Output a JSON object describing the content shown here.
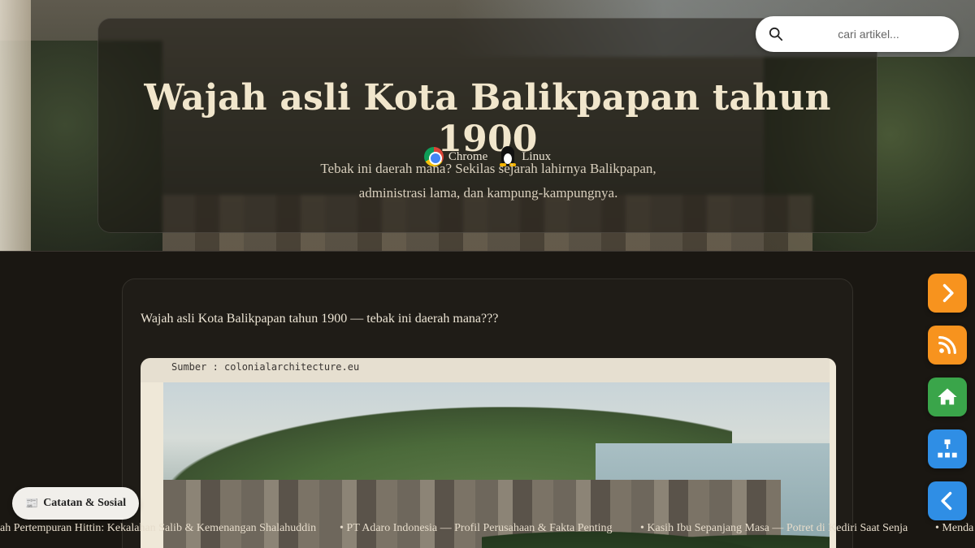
{
  "hero": {
    "title": "Wajah asli Kota Balikpapan tahun 1900",
    "platforms": [
      {
        "label": "Chrome",
        "icon": "chrome-icon"
      },
      {
        "label": "Linux",
        "icon": "tux-icon"
      }
    ],
    "subtitle": "Tebak ini daerah mana? Sekilas sejarah lahirnya Balikpapan, administrasi lama, dan kampung-kampungnya."
  },
  "search": {
    "placeholder": "cari artikel...",
    "icon": "search-icon"
  },
  "article": {
    "lead": "Wajah asli Kota Balikpapan tahun 1900 — tebak ini daerah mana???",
    "image_caption": "Sumber : colonialarchitecture.eu"
  },
  "side_buttons": [
    {
      "name": "next-button",
      "icon": "chevron-right-icon",
      "color": "#f7931e"
    },
    {
      "name": "rss-button",
      "icon": "rss-icon",
      "color": "#f7931e"
    },
    {
      "name": "home-button",
      "icon": "home-icon",
      "color": "#3aa54a"
    },
    {
      "name": "sitemap-button",
      "icon": "sitemap-icon",
      "color": "#2f8ee5"
    },
    {
      "name": "prev-button",
      "icon": "chevron-left-icon",
      "color": "#2f8ee5"
    }
  ],
  "badge": {
    "icon": "newspaper-icon",
    "label": "Catatan & Sosial"
  },
  "ticker": {
    "items": [
      "ah Pertempuran Hittin: Kekalahan Salib & Kemenangan Shalahuddin",
      "• PT Adaro Indonesia — Profil Perusahaan & Fakta Penting",
      "• Kasih Ibu Sepanjang Masa — Potret di Kediri Saat Senja",
      "• Menda"
    ]
  },
  "colors": {
    "accent_orange": "#f7931e",
    "accent_green": "#3aa54a",
    "accent_blue": "#2f8ee5",
    "title": "#f1e6cc",
    "background": "#1a1712"
  }
}
